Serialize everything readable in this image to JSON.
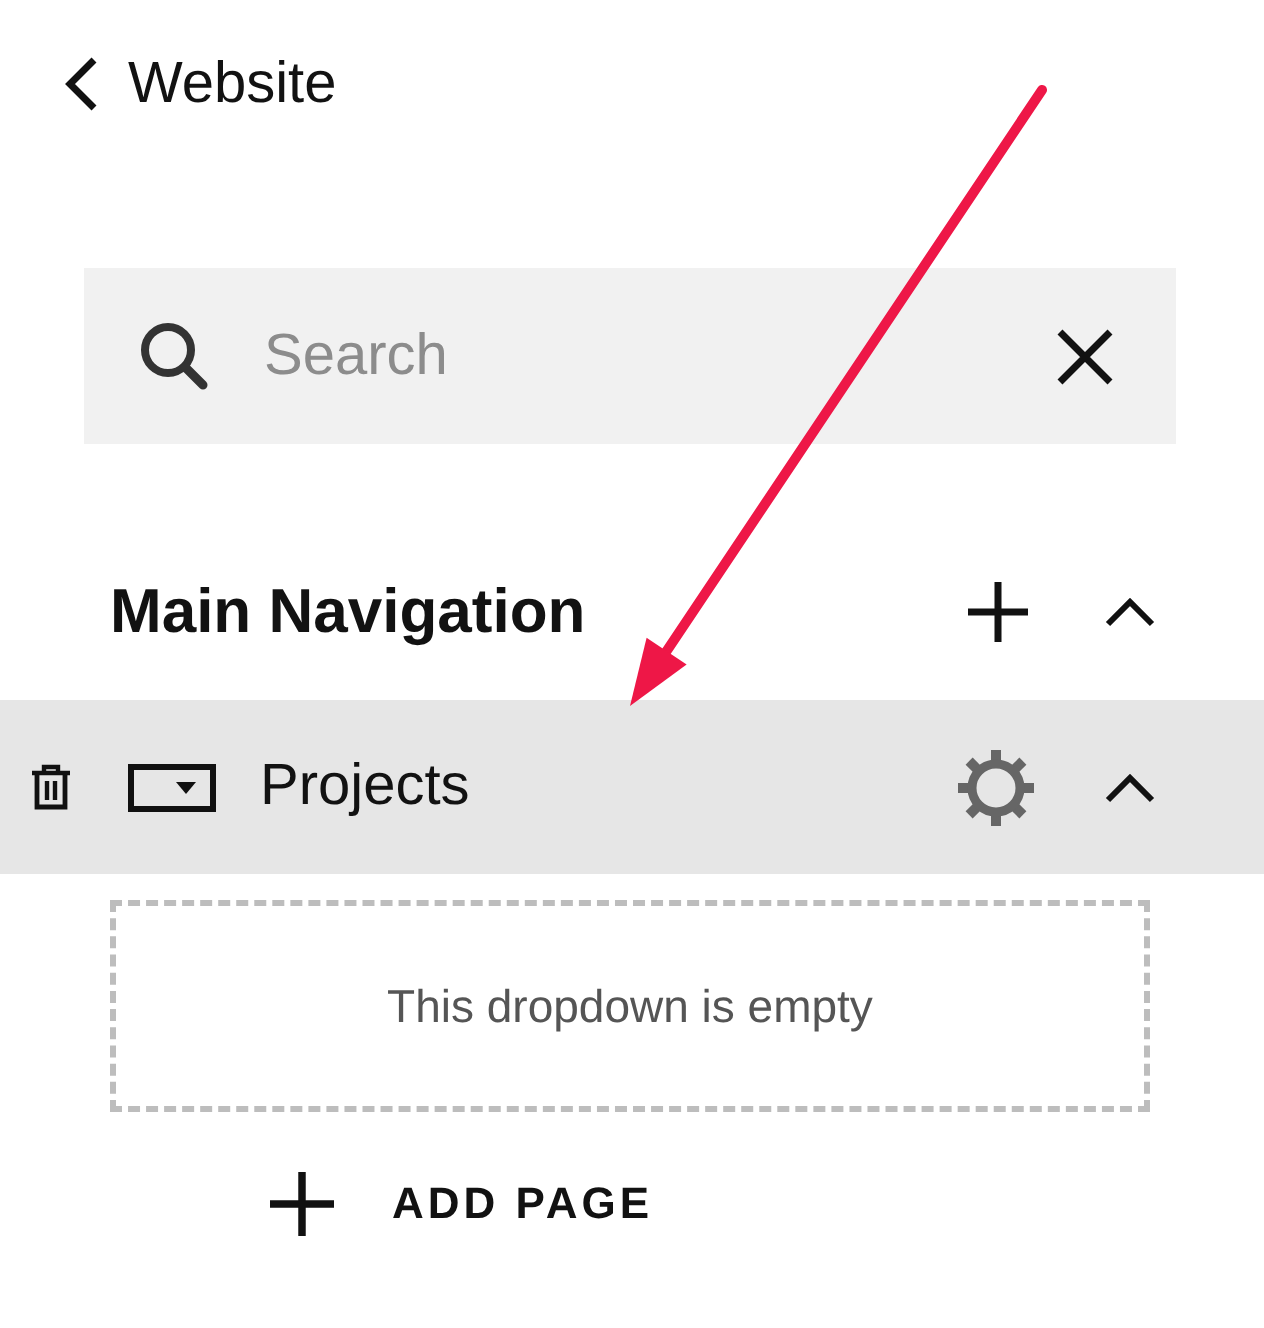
{
  "header": {
    "back_label": "Website"
  },
  "search": {
    "placeholder": "Search"
  },
  "navigation": {
    "title": "Main Navigation",
    "expanded": true,
    "items": [
      {
        "label": "Projects",
        "kind": "dropdown",
        "selected": true,
        "expanded": true,
        "empty_message": "This dropdown is empty"
      }
    ]
  },
  "add_page": {
    "label": "ADD PAGE"
  },
  "annotations": [
    {
      "kind": "arrow"
    }
  ]
}
